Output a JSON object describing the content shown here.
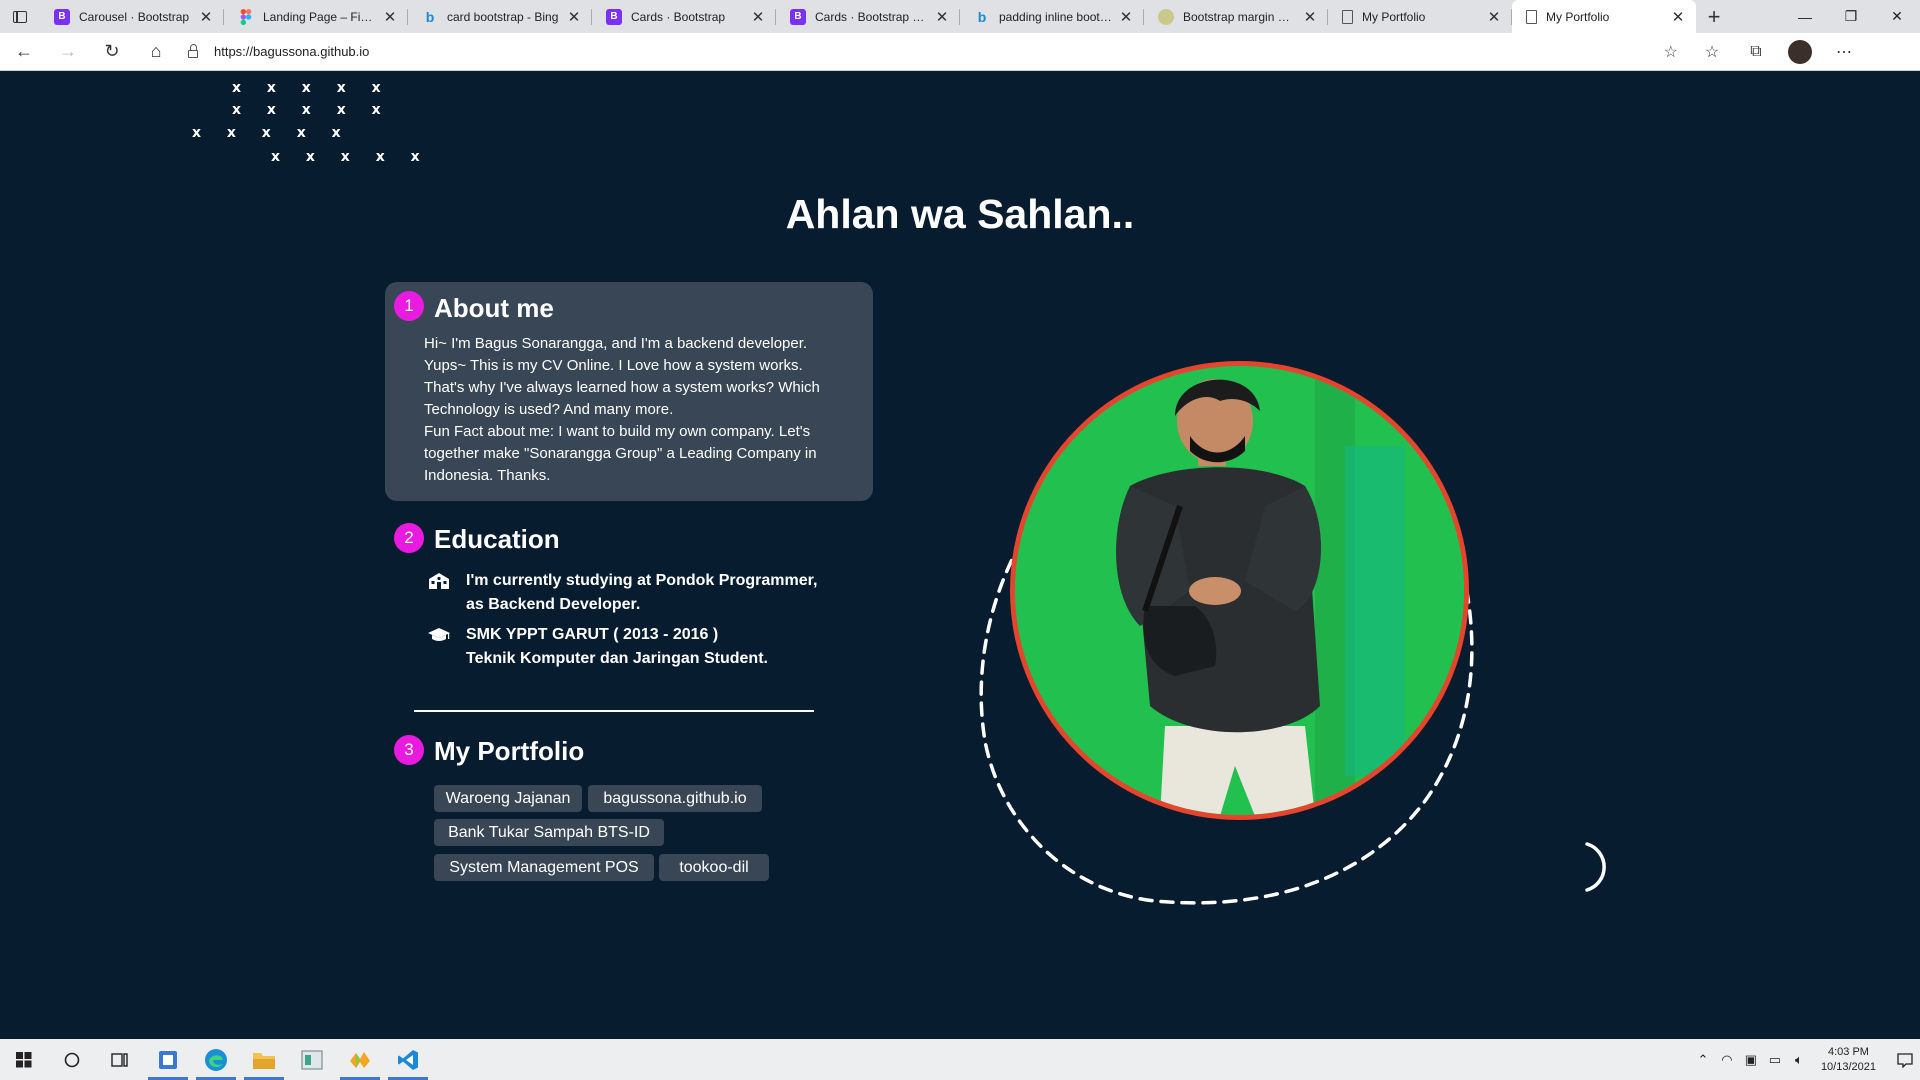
{
  "browser": {
    "tabs": [
      {
        "title": "Carousel · Bootstrap",
        "favicon": "bootstrap-icon"
      },
      {
        "title": "Landing Page – Figma",
        "favicon": "figma-icon"
      },
      {
        "title": "card bootstrap - Bing",
        "favicon": "bing-icon"
      },
      {
        "title": "Cards · Bootstrap",
        "favicon": "bootstrap-icon"
      },
      {
        "title": "Cards · Bootstrap v5.0",
        "favicon": "bootstrap-icon"
      },
      {
        "title": "padding inline bootstrap",
        "favicon": "bing-icon"
      },
      {
        "title": "Bootstrap margin and",
        "favicon": "circle-icon"
      },
      {
        "title": "My Portfolio",
        "favicon": "page-icon"
      },
      {
        "title": "My Portfolio",
        "favicon": "page-icon"
      }
    ],
    "url": "https://bagussona.github.io"
  },
  "page": {
    "x_rows": [
      "x x x x x",
      "x x x x x",
      "x x x x x",
      "x x x x x"
    ],
    "hero_title": "Ahlan wa Sahlan..",
    "about": {
      "number": "1",
      "title": "About me",
      "lines": [
        "Hi~ I'm Bagus Sonarangga, and I'm a backend developer.",
        "Yups~ This is my CV Online. I Love how a system works.",
        "That's why I've always learned how a system works? Which",
        "Technology is used? And many more.",
        "Fun Fact about me: I want to build my own company. Let's",
        "together make \"Sonarangga Group\" a Leading Company in",
        "Indonesia. Thanks."
      ]
    },
    "education": {
      "number": "2",
      "title": "Education",
      "items": [
        {
          "icon": "school-icon",
          "line1": "I'm currently studying at Pondok Programmer,",
          "line2": "as Backend Developer."
        },
        {
          "icon": "graduation-cap-icon",
          "line1": "SMK YPPT GARUT ( 2013 - 2016 )",
          "line2": "Teknik Komputer dan Jaringan Student."
        }
      ]
    },
    "portfolio": {
      "number": "3",
      "title": "My Portfolio",
      "chips": [
        "Waroeng Jajanan",
        "bagussona.github.io",
        "Bank Tukar Sampah BTS-ID",
        "System Management POS",
        "tookoo-dil"
      ]
    }
  },
  "taskbar": {
    "time": "4:03 PM",
    "date": "10/13/2021"
  },
  "colors": {
    "background": "#081c30",
    "card": "#384656",
    "badge": "#ea1be1",
    "photo_border": "#e5452c"
  }
}
